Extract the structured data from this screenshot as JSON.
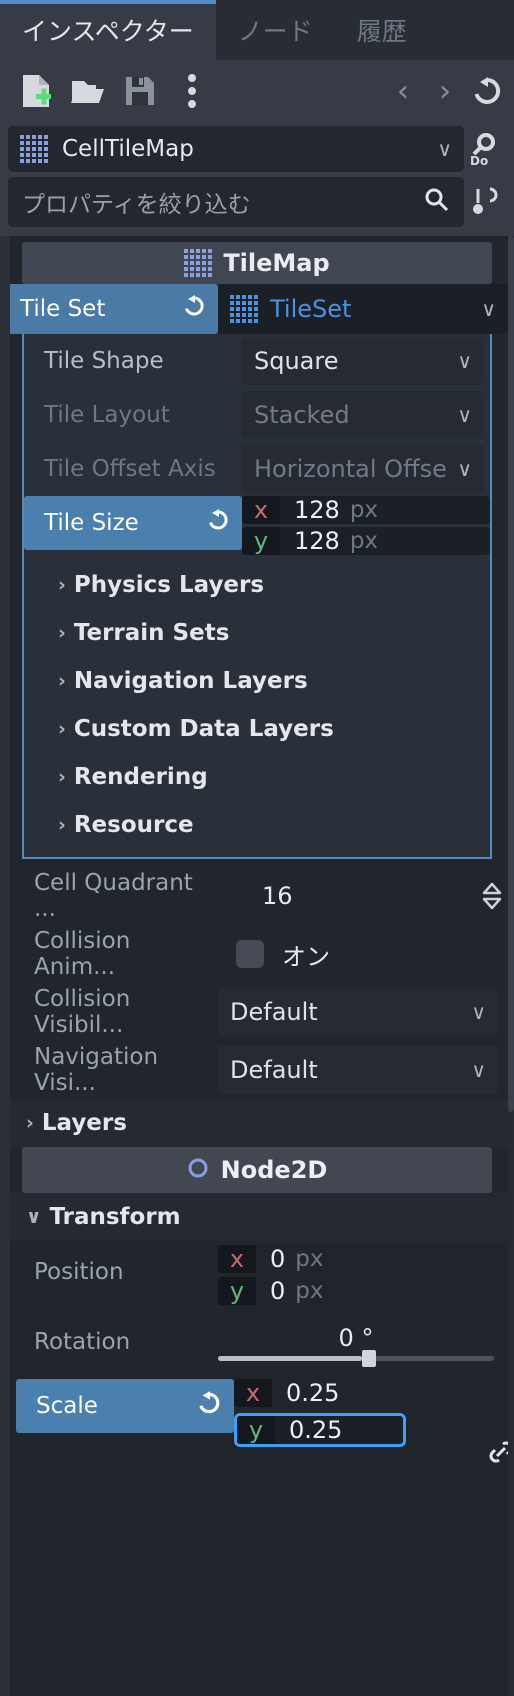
{
  "tabs": [
    {
      "label": "インスペクター",
      "active": true
    },
    {
      "label": "ノード",
      "active": false
    },
    {
      "label": "履歴",
      "active": false
    }
  ],
  "toolbar": {
    "new_icon": "new-file-icon",
    "open_icon": "open-folder-icon",
    "save_icon": "save-icon",
    "menu_icon": "more-options-icon",
    "back_label": "‹",
    "forward_label": "›",
    "history_icon": "history-icon"
  },
  "object": {
    "icon": "tilemap-icon",
    "name": "CellTileMap",
    "chevron": "∨"
  },
  "search": {
    "placeholder": "プロパティを絞り込む",
    "icon": "search-icon"
  },
  "category": {
    "icon": "tilemap-icon",
    "title": "TileMap"
  },
  "tileset_row": {
    "label": "Tile Set",
    "revert_icon": "revert-icon",
    "resource_icon": "tileset-icon",
    "resource_name": "TileSet",
    "chevron": "∨"
  },
  "subinspector": {
    "rows": [
      {
        "name": "Tile Shape",
        "value": "Square",
        "dim": false,
        "selected": false
      },
      {
        "name": "Tile Layout",
        "value": "Stacked",
        "dim": true,
        "selected": false
      },
      {
        "name": "Tile Offset Axis",
        "value": "Horizontal Offse",
        "dim": true,
        "selected": false
      }
    ],
    "tile_size": {
      "label": "Tile Size",
      "revert_icon": "revert-icon",
      "x_axis": "x",
      "x_value": "128",
      "x_unit": "px",
      "y_axis": "y",
      "y_value": "128",
      "y_unit": "px"
    },
    "sections": [
      {
        "label": "Physics Layers",
        "arrow": "›"
      },
      {
        "label": "Terrain Sets",
        "arrow": "›"
      },
      {
        "label": "Navigation Layers",
        "arrow": "›"
      },
      {
        "label": "Custom Data Layers",
        "arrow": "›"
      },
      {
        "label": "Rendering",
        "arrow": "›"
      },
      {
        "label": "Resource",
        "arrow": "›"
      }
    ]
  },
  "tilemap_props": {
    "cell_quadrant": {
      "label": "Cell Quadrant ...",
      "value": "16",
      "spinner_icon": "stepper-icon"
    },
    "collision_animatable": {
      "label": "Collision Anim...",
      "checkbox_icon": "checkbox-unchecked-icon",
      "value": "オン"
    },
    "collision_visibility": {
      "label": "Collision Visibil...",
      "value": "Default",
      "chevron": "∨"
    },
    "navigation_visibility": {
      "label": "Navigation Visi...",
      "value": "Default",
      "chevron": "∨"
    },
    "layers_section": {
      "label": "Layers",
      "arrow": "›"
    }
  },
  "node2d": {
    "icon": "node2d-icon",
    "title": "Node2D",
    "transform_section": {
      "label": "Transform",
      "arrow": "∨"
    },
    "position": {
      "label": "Position",
      "x_axis": "x",
      "x_value": "0",
      "x_unit": "px",
      "y_axis": "y",
      "y_value": "0",
      "y_unit": "px"
    },
    "rotation": {
      "label": "Rotation",
      "value": "0 °",
      "slider_percent": 52
    },
    "scale": {
      "label": "Scale",
      "revert_icon": "revert-icon",
      "x_axis": "x",
      "x_value": "0.25",
      "y_axis": "y",
      "y_value": "0.25",
      "link_icon": "link-icon"
    }
  },
  "colors": {
    "accent_blue": "#4f8cc9",
    "focus_blue": "#3fa0f5",
    "selected_row": "#4a7aa5",
    "resource_text": "#4b93e0",
    "axis_x": "#c46b6b",
    "axis_y": "#63b67f"
  }
}
